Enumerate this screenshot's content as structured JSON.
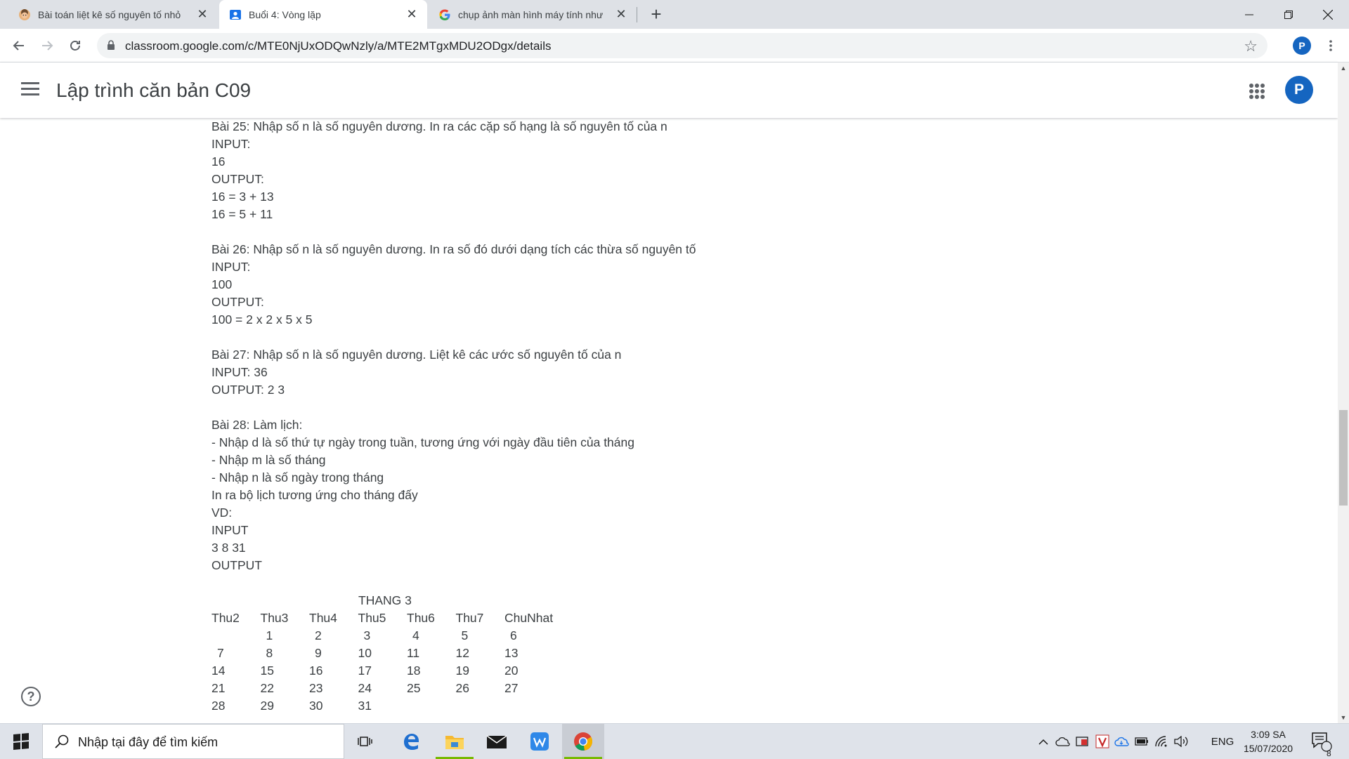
{
  "browser": {
    "tabs": [
      {
        "title": "Bài toán liệt kê số nguyên tố nhỏ",
        "active": false
      },
      {
        "title": "Buổi 4: Vòng lặp",
        "active": true
      },
      {
        "title": "chụp ảnh màn hình máy tính như",
        "active": false
      }
    ],
    "new_tab_label": "+",
    "url": "classroom.google.com/c/MTE0NjUxODQwNzly/a/MTE2MTgxMDU2ODgx/details",
    "profile_initial": "P"
  },
  "classroom": {
    "title": "Lập trình căn bản C09",
    "avatar_initial": "P",
    "help_glyph": "?"
  },
  "content": {
    "lines": [
      "Bài 25: Nhập số n là số nguyên dương. In ra các cặp số hạng là số nguyên tố của n",
      "INPUT:",
      "16",
      "OUTPUT:",
      "16 = 3 + 13",
      "16 = 5 + 11",
      "",
      "Bài 26: Nhập số n là số nguyên dương. In ra số đó dưới dạng tích các thừa số nguyên tố",
      "INPUT:",
      "100",
      "OUTPUT:",
      "100 = 2 x 2 x 5 x 5",
      "",
      "Bài 27: Nhập số n là số nguyên dương. Liệt kê các ước số nguyên tố của n",
      "INPUT: 36",
      "OUTPUT: 2 3",
      "",
      "Bài 28: Làm lịch:",
      "- Nhập d là số thứ tự ngày trong tuần, tương ứng với ngày đầu tiên của tháng",
      "- Nhập m là số tháng",
      "- Nhập n là số ngày trong tháng",
      "In ra bộ lịch tương ứng cho tháng đấy",
      "VD:",
      "INPUT",
      "3 8 31",
      "OUTPUT",
      ""
    ],
    "calendar": {
      "title": "THANG 3",
      "headers": [
        "Thu2",
        "Thu3",
        "Thu4",
        "Thu5",
        "Thu6",
        "Thu7",
        "ChuNhat"
      ],
      "rows": [
        [
          "",
          "1",
          "2",
          "3",
          "4",
          "5",
          "6"
        ],
        [
          "7",
          "8",
          "9",
          "10",
          "11",
          "12",
          "13"
        ],
        [
          "14",
          "15",
          "16",
          "17",
          "18",
          "19",
          "20"
        ],
        [
          "21",
          "22",
          "23",
          "24",
          "25",
          "26",
          "27"
        ],
        [
          "28",
          "29",
          "30",
          "31",
          "",
          "",
          ""
        ]
      ]
    }
  },
  "scroll": {
    "position_fraction": 0.62,
    "visible_fraction": 0.15
  },
  "taskbar": {
    "search_placeholder": "Nhập tại đây để tìm kiếm",
    "apps": [
      "task-view-icon",
      "edge-icon",
      "file-explorer-icon",
      "mail-icon",
      "wps-office-icon",
      "chrome-icon"
    ],
    "language": "ENG",
    "time": "3:09 SA",
    "date": "15/07/2020",
    "notification_count": "8"
  },
  "colors": {
    "accent_blue": "#1565c0",
    "tab_strip": "#dee1e6",
    "taskbar": "#dfe3ea",
    "open_app_indicator": "#76b900"
  }
}
